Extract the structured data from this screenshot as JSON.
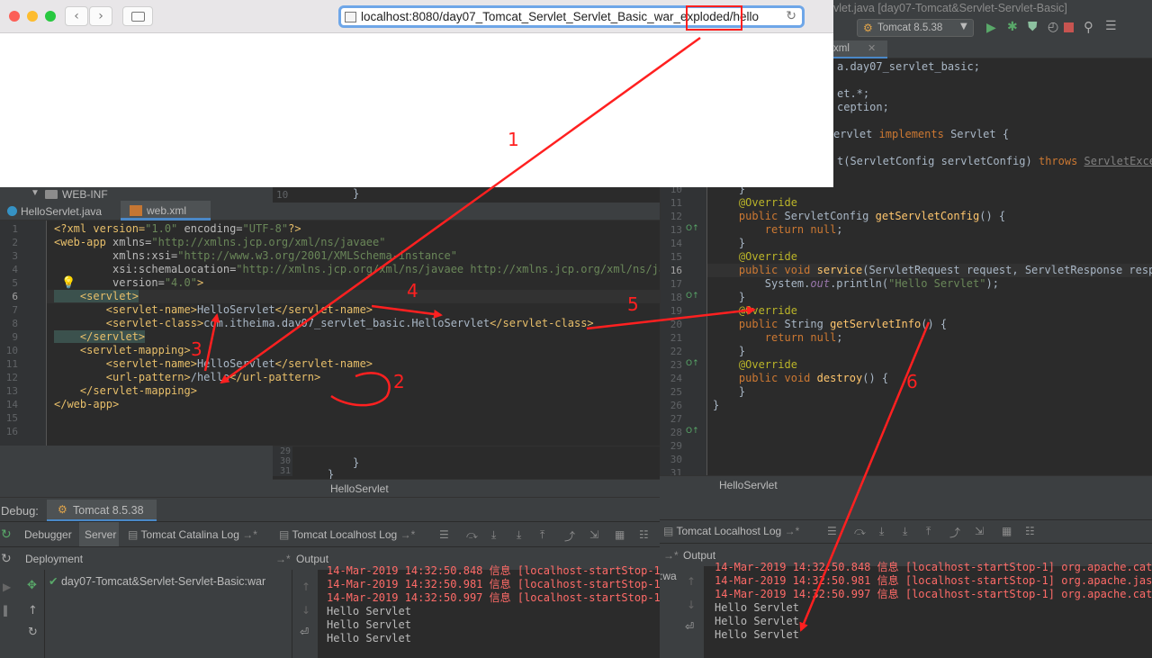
{
  "browser": {
    "url_text": "localhost:8080/day07_Tomcat_Servlet_Servlet_Basic_war_exploded/hello",
    "back_icon": "chevron-left-icon",
    "forward_icon": "chevron-right-icon",
    "sidebar_icon": "sidebar-icon",
    "reload_icon": "reload-icon"
  },
  "ide_title": "vlet.java [day07-Tomcat&Servlet-Servlet-Basic]",
  "run_config": "Tomcat 8.5.38",
  "project_tree": {
    "folder": "WEB-INF",
    "line10": "10",
    "brace": "}"
  },
  "left_editor": {
    "tabs": [
      {
        "label": "HelloServlet.java",
        "active": false
      },
      {
        "label": "web.xml",
        "active": true
      }
    ],
    "gutter": [
      "1",
      "2",
      "3",
      "4",
      "5",
      "6",
      "7",
      "8",
      "9",
      "10",
      "11",
      "12",
      "13",
      "14",
      "15",
      "16"
    ],
    "lines": [
      [
        "<?xml version=",
        "\"1.0\"",
        " encoding=",
        "\"UTF-8\"",
        "?>"
      ],
      [
        "<web-app ",
        "xmlns=",
        "\"http://xmlns.jcp.org/xml/ns/javaee\""
      ],
      [
        "         xmlns:xsi=",
        "\"http://www.w3.org/2001/XMLSchema-instance\""
      ],
      [
        "         xsi:schemaLocation=",
        "\"http://xmlns.jcp.org/xml/ns/javaee http://xmlns.jcp.org/xml/ns/java"
      ],
      [
        "         version=",
        "\"4.0\"",
        ">"
      ],
      [
        "    <servlet>"
      ],
      [
        "        <servlet-name>",
        "HelloServlet",
        "</servlet-name>"
      ],
      [
        "        <servlet-class>",
        "com.itheima.day07_servlet_basic.HelloServlet",
        "</servlet-class>"
      ],
      [
        "    </servlet>"
      ],
      [
        ""
      ],
      [
        "    <servlet-mapping>"
      ],
      [
        "        <servlet-name>",
        "HelloServlet",
        "</servlet-name>"
      ],
      [
        "        <url-pattern>",
        "/hello",
        "</url-pattern>"
      ],
      [
        "    </servlet-mapping>"
      ],
      [
        "</web-app>"
      ],
      [
        ""
      ]
    ]
  },
  "under_editor": {
    "lines": [
      "29",
      "30",
      "31"
    ],
    "brace1": "}",
    "brace2": "}",
    "breadcrumb": "HelloServlet"
  },
  "right_editor": {
    "tab_label": "xml",
    "top_lines": [
      [
        "a.day07_servlet_basic;"
      ],
      [
        ""
      ],
      [
        "et.*;"
      ],
      [
        "ception;"
      ],
      [
        ""
      ],
      [
        "ervlet ",
        "implements ",
        "Servlet {"
      ],
      [
        ""
      ],
      [
        "t(ServletConfig servletConfig) ",
        "throws ",
        "ServletExcep"
      ]
    ],
    "gutter": [
      "10",
      "11",
      "12",
      "13",
      "14",
      "15",
      "16",
      "17",
      "18",
      "19",
      "20",
      "21",
      "22",
      "23",
      "24",
      "25",
      "26",
      "27",
      "28",
      "29",
      "30",
      "31"
    ],
    "code": [
      "    }",
      "",
      "    @Override",
      "    public ServletConfig getServletConfig() {",
      "        return null;",
      "    }",
      "",
      "    @Override",
      "    public void service(ServletRequest request, ServletResponse respo",
      "        System.out.println(\"Hello Servlet\");",
      "    }",
      "",
      "    @Override",
      "    public String getServletInfo() {",
      "        return null;",
      "    }",
      "",
      "    @Override",
      "    public void destroy() {",
      "",
      "    }",
      "}"
    ],
    "breadcrumb": "HelloServlet"
  },
  "debug_panel": {
    "label": "Debug:",
    "config": "Tomcat 8.5.38",
    "tabs": [
      "Debugger",
      "Server",
      "Tomcat Catalina Log",
      "Tomcat Localhost Log"
    ],
    "deployment_header": "Deployment",
    "output_header": "Output",
    "deployment_item": "day07-Tomcat&Servlet-Servlet-Basic:war",
    "console": [
      {
        "text": "14-Mar-2019 14:32:50.848 信息 [localhost-startStop-1]",
        "type": "red"
      },
      {
        "text": "14-Mar-2019 14:32:50.981 信息 [localhost-startStop-1]",
        "type": "red"
      },
      {
        "text": "14-Mar-2019 14:32:50.997 信息 [localhost-startStop-1]",
        "type": "red"
      },
      {
        "text": "Hello Servlet",
        "type": "wht"
      },
      {
        "text": "Hello Servlet",
        "type": "wht"
      },
      {
        "text": "Hello Servlet",
        "type": "wht"
      }
    ]
  },
  "right_console": {
    "tab": "Tomcat Localhost Log",
    "output_header": "Output",
    "side_text": ":wa",
    "console": [
      {
        "text": "14-Mar-2019 14:32:50.848 信息 [localhost-startStop-1] org.apache.catal",
        "type": "red"
      },
      {
        "text": "14-Mar-2019 14:32:50.981 信息 [localhost-startStop-1] org.apache.jasp",
        "type": "red"
      },
      {
        "text": "14-Mar-2019 14:32:50.997 信息 [localhost-startStop-1] org.apache.cata",
        "type": "red"
      },
      {
        "text": "Hello Servlet",
        "type": "wht"
      },
      {
        "text": "Hello Servlet",
        "type": "wht"
      },
      {
        "text": "Hello Servlet",
        "type": "wht"
      }
    ]
  },
  "annotations": {
    "labels": [
      "1",
      "2",
      "3",
      "4",
      "5",
      "6"
    ],
    "color": "#ff2020"
  }
}
